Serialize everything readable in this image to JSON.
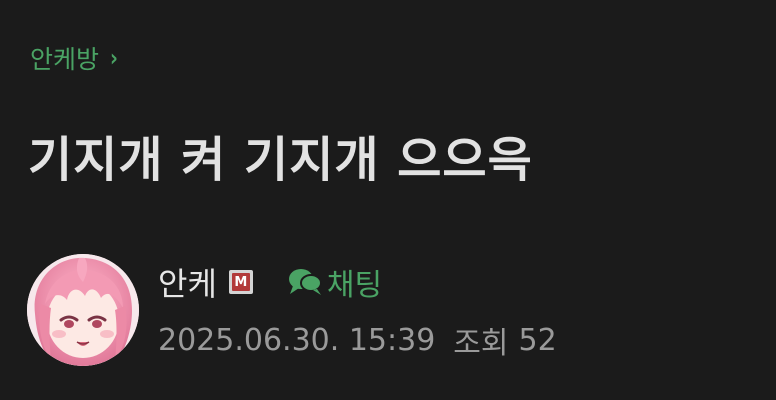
{
  "board": {
    "name": "안케방",
    "chevron": "›"
  },
  "post": {
    "title": "기지개 켜 기지개 으으윽"
  },
  "author": {
    "nickname": "안케",
    "badge": "M",
    "chat_label": "채팅",
    "avatar_icon": "anime-avatar-icon"
  },
  "meta": {
    "date": "2025.06.30. 15:39",
    "views_label": "조회",
    "views_count": "52"
  },
  "colors": {
    "background": "#1b1b1b",
    "accent_green": "#4aa364",
    "title_text": "#e2e2e2",
    "meta_text": "#9a9a9a",
    "badge_red": "#b23a3a"
  }
}
